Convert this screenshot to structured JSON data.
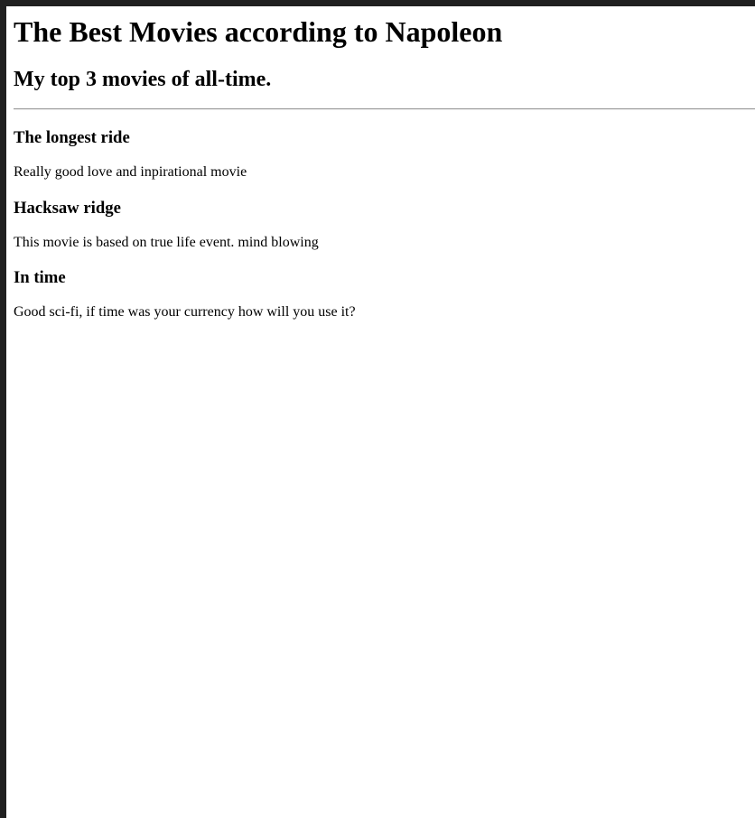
{
  "page": {
    "title": "The Best Movies according to Napoleon",
    "subtitle": "My top 3 movies of all-time."
  },
  "movies": [
    {
      "name": "The longest ride",
      "description": "Really good love and inpirational movie"
    },
    {
      "name": "Hacksaw ridge",
      "description": "This movie is based on true life event. mind blowing"
    },
    {
      "name": "In time",
      "description": "Good sci-fi, if time was your currency how will you use it?"
    }
  ]
}
